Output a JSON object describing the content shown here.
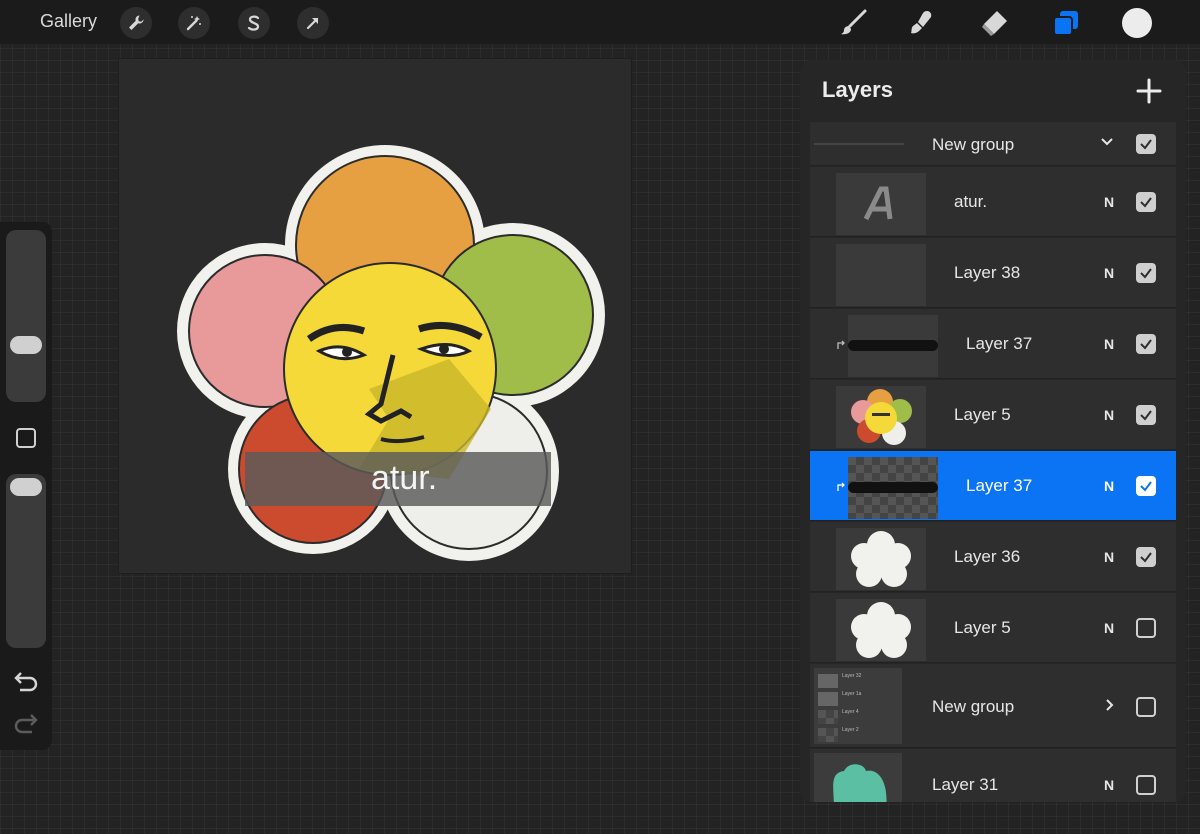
{
  "topbar": {
    "gallery_label": "Gallery",
    "left_tools": [
      "wrench-icon",
      "magic-wand-icon",
      "selection-s-icon",
      "transform-arrow-icon"
    ],
    "right_tools": [
      "brush-icon",
      "smudge-icon",
      "eraser-icon",
      "layers-icon"
    ],
    "current_color": "#ececec",
    "accent": "#0a74f5"
  },
  "canvas": {
    "title_text": "atur.",
    "petal_colors": [
      "#e6a042",
      "#e79a99",
      "#9fbd48",
      "#cc4b2f",
      "#eeefea"
    ],
    "face_color": "#f5d938"
  },
  "layers": {
    "title": "Layers",
    "add_label": "+",
    "rows": [
      {
        "name": "New group",
        "mode": "",
        "visible": true,
        "type": "group-expanded"
      },
      {
        "name": "atur.",
        "mode": "N",
        "visible": true,
        "type": "text"
      },
      {
        "name": "Layer 38",
        "mode": "N",
        "visible": true,
        "type": "empty"
      },
      {
        "name": "Layer 37",
        "mode": "N",
        "visible": true,
        "type": "clip"
      },
      {
        "name": "Layer 5",
        "mode": "N",
        "visible": true,
        "type": "art"
      },
      {
        "name": "Layer 37",
        "mode": "N",
        "visible": true,
        "type": "clip-selected"
      },
      {
        "name": "Layer 36",
        "mode": "N",
        "visible": true,
        "type": "flower"
      },
      {
        "name": "Layer 5",
        "mode": "N",
        "visible": false,
        "type": "flower"
      },
      {
        "name": "New group",
        "mode": "",
        "visible": false,
        "type": "group-collapsed"
      },
      {
        "name": "Layer 31",
        "mode": "N",
        "visible": false,
        "type": "teal"
      }
    ],
    "group_thumb_rows": [
      "Layer 32",
      "Layer 1a",
      "Layer 4",
      "Layer 2"
    ]
  }
}
